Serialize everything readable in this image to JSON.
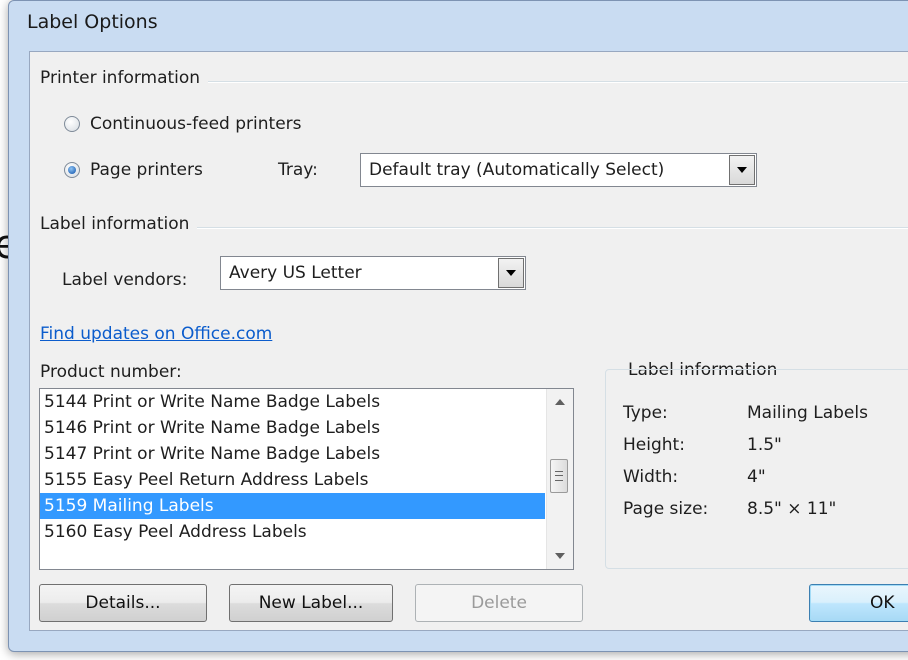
{
  "background_text": "e,",
  "dialog": {
    "title": "Label Options"
  },
  "printer_info": {
    "group_label": "Printer information",
    "continuous_label": "Continuous-feed printers",
    "continuous_selected": false,
    "page_label": "Page printers",
    "page_selected": true,
    "tray_label": "Tray:",
    "tray_value": "Default tray (Automatically Select)"
  },
  "label_info": {
    "group_label": "Label information",
    "vendors_label": "Label vendors:",
    "vendors_value": "Avery US Letter",
    "updates_link": "Find updates on Office.com"
  },
  "product": {
    "label": "Product number:",
    "items": [
      "5144 Print or Write Name Badge Labels",
      "5146 Print or Write Name Badge Labels",
      "5147 Print or Write Name Badge Labels",
      "5155 Easy Peel Return Address Labels",
      "5159 Mailing Labels",
      "5160 Easy Peel Address Labels"
    ],
    "selected_index": 4
  },
  "details_panel": {
    "title": "Label information",
    "rows": [
      {
        "key": "Type:",
        "value": "Mailing Labels"
      },
      {
        "key": "Height:",
        "value": "1.5\""
      },
      {
        "key": "Width:",
        "value": "4\""
      },
      {
        "key": "Page size:",
        "value": "8.5\" × 11\""
      }
    ]
  },
  "buttons": {
    "details": "Details...",
    "new_label": "New Label...",
    "delete": "Delete",
    "ok": "OK"
  },
  "colors": {
    "selection": "#3399ff",
    "link": "#0b5ccc",
    "title_bar": "#c9dcf2"
  }
}
